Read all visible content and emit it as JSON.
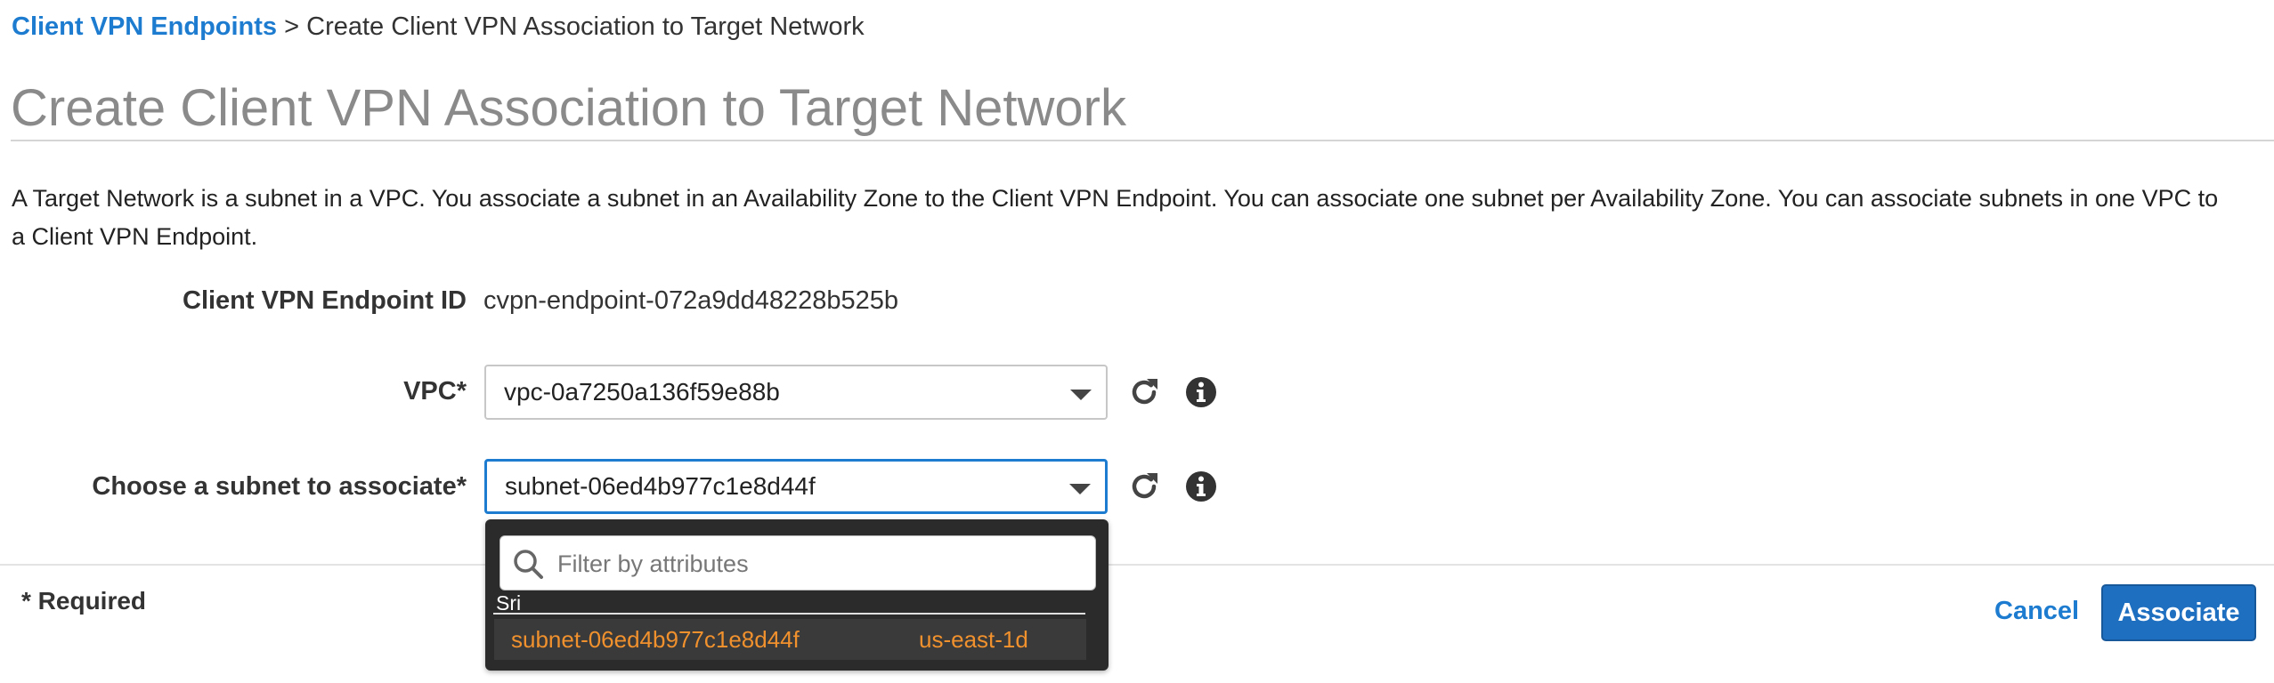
{
  "breadcrumb": {
    "parent": "Client VPN Endpoints",
    "separator": " > ",
    "current": "Create Client VPN Association to Target Network"
  },
  "page": {
    "title": "Create Client VPN Association to Target Network",
    "description": "A Target Network is a subnet in a VPC. You associate a subnet in an Availability Zone to the Client VPN Endpoint. You can associate one subnet per Availability Zone. You can associate subnets in one VPC to a Client VPN Endpoint."
  },
  "form": {
    "endpoint_label": "Client VPN Endpoint ID",
    "endpoint_value": "cvpn-endpoint-072a9dd48228b525b",
    "vpc_label": "VPC*",
    "vpc_value": "vpc-0a7250a136f59e88b",
    "subnet_label": "Choose a subnet to associate*",
    "subnet_value": "subnet-06ed4b977c1e8d44f"
  },
  "dropdown": {
    "filter_placeholder": "Filter by attributes",
    "group_label": "Sri",
    "options": [
      {
        "subnet": "subnet-06ed4b977c1e8d44f",
        "az": "us-east-1d"
      }
    ]
  },
  "footer": {
    "required_note": "* Required",
    "cancel_label": "Cancel",
    "associate_label": "Associate"
  },
  "icons": {
    "refresh": "refresh-icon",
    "info": "info-icon",
    "dropdown": "chevron-down-icon",
    "search": "search-icon"
  },
  "colors": {
    "link": "#1d7ccf",
    "primary_button": "#1f6fc1",
    "option_text": "#f0912e",
    "dropdown_bg": "#2b2b2b"
  }
}
